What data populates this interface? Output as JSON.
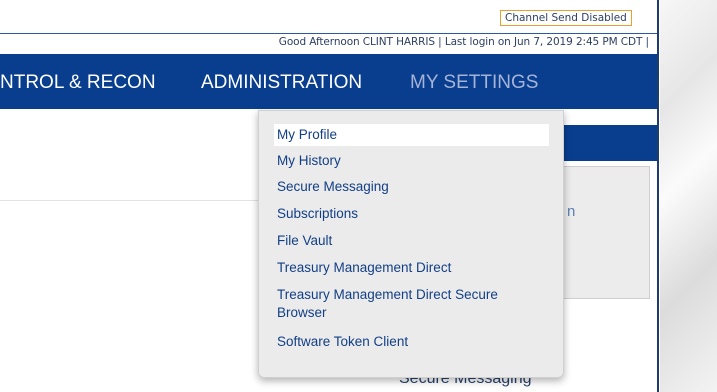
{
  "header": {
    "channel_status": "Channel Send Disabled",
    "greeting": "Good Afternoon CLINT HARRIS | Last login on Jun 7, 2019 2:45 PM CDT |"
  },
  "nav": {
    "items": [
      {
        "label": "NTROL & RECON"
      },
      {
        "label": "ADMINISTRATION"
      },
      {
        "label": "MY SETTINGS",
        "active": true
      }
    ]
  },
  "my_settings_menu": {
    "items": [
      {
        "label": "My Profile",
        "hovered": true
      },
      {
        "label": "My History"
      },
      {
        "label": "Secure Messaging"
      },
      {
        "label": "Subscriptions"
      },
      {
        "label": "File Vault"
      },
      {
        "label": "Treasury Management Direct"
      },
      {
        "label": "Treasury Management Direct Secure Browser"
      },
      {
        "label": "Software Token Client"
      }
    ]
  },
  "background_content": {
    "panel_partial_text": "n",
    "secure_messaging_link": "Secure Messaging"
  },
  "colors": {
    "nav_background": "#093e8f",
    "nav_active_text": "#a4b3d6",
    "menu_link": "#123f86",
    "status_border": "#e8a033"
  }
}
